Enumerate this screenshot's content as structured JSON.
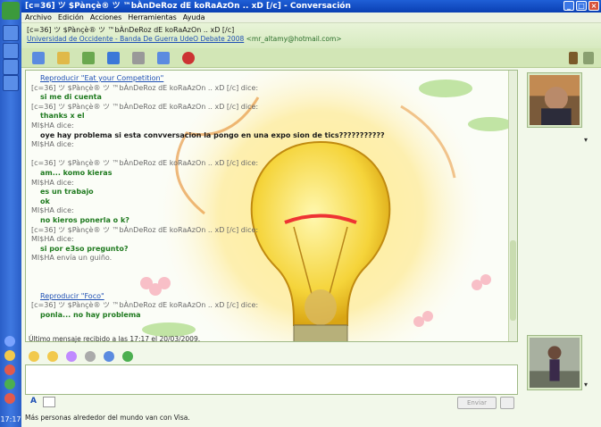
{
  "window": {
    "title": "[c=36] ツ $Pànçè® ツ ™bÀnDeRoz dE koRaAzOn .. xD [/c] - Conversación"
  },
  "menu": [
    "Archivo",
    "Edición",
    "Acciones",
    "Herramientas",
    "Ayuda"
  ],
  "contact": {
    "name": "[c=36] ツ $Pànçè® ツ ™bÀnDeRoz dE koRaAzOn .. xD [/c]",
    "link_text": "Universidad de Occidente - Banda De Guerra UdeO Debate 2008",
    "email": "<mr_altamy@hotmail.com>"
  },
  "messages": [
    {
      "type": "link",
      "text": "Reproducir \"Eat your Competition\""
    },
    {
      "type": "sender",
      "text": "[c=36] ツ $Pànçè® ツ ™bÀnDeRoz dE koRaAzOn .. xD [/c] dice:"
    },
    {
      "type": "text",
      "text": "si me di cuenta"
    },
    {
      "type": "sender",
      "text": "[c=36] ツ $Pànçè® ツ ™bÀnDeRoz dE koRaAzOn .. xD [/c] dice:"
    },
    {
      "type": "text",
      "text": "thanks x el"
    },
    {
      "type": "sender",
      "text": "MI$HA dice:"
    },
    {
      "type": "text-dark",
      "text": "oye hay problema si esta convversacion la pongo en una expo sion de tics???????????"
    },
    {
      "type": "sender",
      "text": "MI$HA dice:"
    },
    {
      "type": "emoticon",
      "text": ""
    },
    {
      "type": "sender",
      "text": "[c=36] ツ $Pànçè® ツ ™bÀnDeRoz dE koRaAzOn .. xD [/c] dice:"
    },
    {
      "type": "text",
      "text": "am... komo kieras"
    },
    {
      "type": "sender",
      "text": "MI$HA dice:"
    },
    {
      "type": "text",
      "text": "es un trabajo"
    },
    {
      "type": "text",
      "text": "ok"
    },
    {
      "type": "sender",
      "text": "MI$HA dice:"
    },
    {
      "type": "text",
      "text": "no kieros ponerla o k?"
    },
    {
      "type": "sender",
      "text": "[c=36] ツ $Pànçè® ツ ™bÀnDeRoz dE koRaAzOn .. xD [/c] dice:"
    },
    {
      "type": "sender",
      "text": "MI$HA dice:"
    },
    {
      "type": "text",
      "text": "si por e3so pregunto?"
    },
    {
      "type": "sender",
      "text": "MI$HA envía un guiño."
    },
    {
      "type": "spacer",
      "text": ""
    },
    {
      "type": "spacer",
      "text": ""
    },
    {
      "type": "spacer",
      "text": ""
    },
    {
      "type": "link",
      "text": "Reproducir \"Foco\""
    },
    {
      "type": "sender",
      "text": "[c=36] ツ $Pànçè® ツ ™bÀnDeRoz dE koRaAzOn .. xD [/c] dice:"
    },
    {
      "type": "text",
      "text": "ponla... no hay problema"
    }
  ],
  "status_line": "Último mensaje recibido a las 17:17 el 20/03/2009.",
  "send_label": "Enviar",
  "footer_text": "Más personas alrededor del mundo van con Visa.",
  "clock": "17:17",
  "colors": {
    "title_bar": "#0a3fb3",
    "theme_green": "#d2e6b6",
    "message_green": "#1f7a1f",
    "link_blue": "#1e4fb4"
  }
}
